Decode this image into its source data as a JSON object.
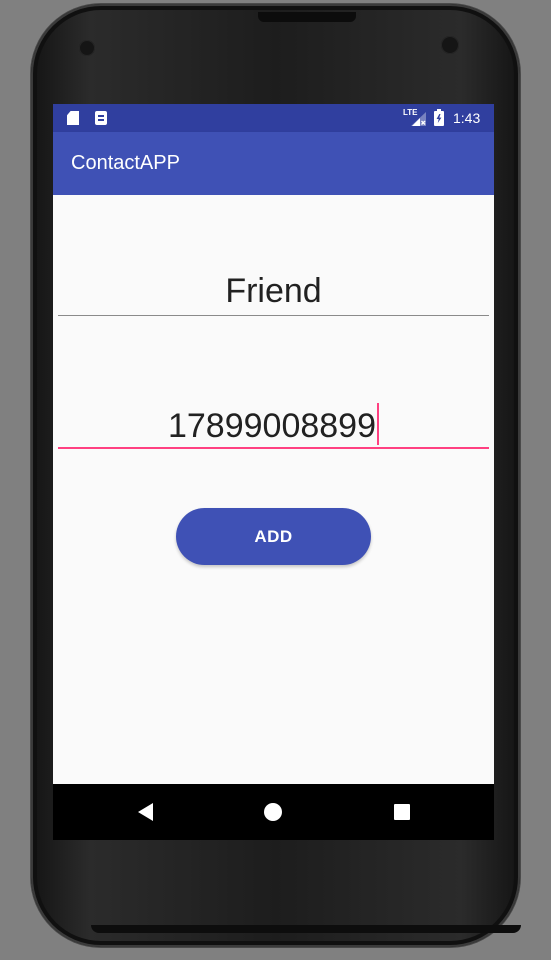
{
  "status_bar": {
    "network_label": "LTE",
    "time": "1:43",
    "icons": [
      "sd-card-icon",
      "notification-icon",
      "signal-icon",
      "battery-charging-icon"
    ]
  },
  "toolbar": {
    "title": "ContactAPP"
  },
  "form": {
    "name_value": "Friend",
    "phone_value": "17899008899",
    "add_label": "ADD"
  },
  "nav_bar": {
    "icons": [
      "back-icon",
      "home-icon",
      "recents-icon"
    ]
  },
  "colors": {
    "status_bar": "#303f9f",
    "primary": "#3f51b5",
    "accent": "#ff4081",
    "background": "#fafafa",
    "nav_bar": "#000000"
  }
}
